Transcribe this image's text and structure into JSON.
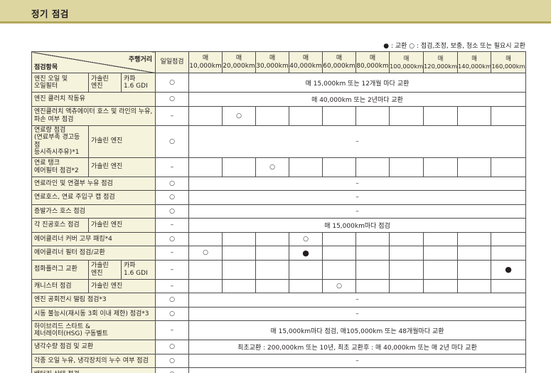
{
  "header": {
    "title": "정기 점검"
  },
  "legend": {
    "text": "● : 교환 ○ : 점검,조정, 보충, 청소 또는 필요시 교환"
  },
  "table": {
    "corner_distance": "주행거리",
    "corner_item": "점검항목",
    "columns": [
      "일일점검",
      "매\n10,000km",
      "매\n20,000km",
      "매\n30,000km",
      "매\n40,000km",
      "매\n60,000km",
      "매\n80,000km",
      "매\n100,000km",
      "매\n120,000km",
      "매\n140,000km",
      "매\n160,000km"
    ],
    "marks": {
      "check": "○",
      "replace": "●",
      "dash": "–"
    },
    "rows": [
      {
        "item": "엔진 오일 및\n오일필터",
        "sub1": "가솔린\n엔진",
        "sub2": "카파\n1.6 GDI",
        "daily": "○",
        "span": "매 15,000km 또는 12개월 마다 교환"
      },
      {
        "item": "엔진 클러치 작동유",
        "daily": "○",
        "span": "매 40,000km 또는 2년마다 교환"
      },
      {
        "item": "엔진클러치 액츄에이터 호스 및 라인의 누유,\n파손 여부 점검",
        "daily": "–",
        "col_20000": "○"
      },
      {
        "item": "연료량 점검\n(연료부족 경고등 점\n등시즉시주유)*1",
        "sub1": "가솔린 엔진",
        "daily": "○",
        "span": "–"
      },
      {
        "item": "연료 탱크\n에어필터 점검*2",
        "sub1": "가솔린 엔진",
        "daily": "–",
        "col_30000": "○"
      },
      {
        "item": "연료라인 및 연결부 누유 점검",
        "daily": "○",
        "span": "–"
      },
      {
        "item": "연료호스, 연료 주입구 캡 점검",
        "daily": "○",
        "span": "–"
      },
      {
        "item": "증발가스 호스 점검",
        "daily": "○",
        "span": "–"
      },
      {
        "item": "각 진공호스 점검",
        "sub1": "가솔린 엔진",
        "daily": "–",
        "span": "매 15,000km마다 점검"
      },
      {
        "item": "에어클리너 커버 고무 패킹*4",
        "daily": "○",
        "col_40000": "○"
      },
      {
        "item": "에어클리너 필터 점검/교환",
        "daily": "–",
        "col_10000": "○",
        "col_40000": "●"
      },
      {
        "item": "점화플러그 교환",
        "sub1": "가솔린\n엔진",
        "sub2": "카파\n1.6 GDI",
        "daily": "–",
        "col_160000": "●"
      },
      {
        "item": "캐니스터 점검",
        "sub1": "가솔린 엔진",
        "daily": "–",
        "col_60000": "○"
      },
      {
        "item": "엔진 공회전시 떨림 점검*3",
        "daily": "○",
        "span": "–"
      },
      {
        "item": "시동 불능시(재시동 3회 이내 제한) 점검*3",
        "daily": "○",
        "span": "–"
      },
      {
        "item": "하이브리드 스타트 &\n제너레이터(HSG) 구동벨트",
        "daily": "–",
        "span": "매 15,000km마다 점검, 매105,000km 또는 48개월마다 교환"
      },
      {
        "item": "냉각수량 점검 및 교환",
        "daily": "○",
        "span": "최초교환 : 200,000km 또는 10년, 최초 교환후 : 매 40,000km 또는 매 2년 마다 교환"
      },
      {
        "item": "각종 오일 누유, 냉각장치의 누수 여부 점검",
        "daily": "○",
        "span": "–"
      },
      {
        "item": "배터리 상태 점검",
        "daily": "○",
        "span": "–"
      }
    ]
  }
}
